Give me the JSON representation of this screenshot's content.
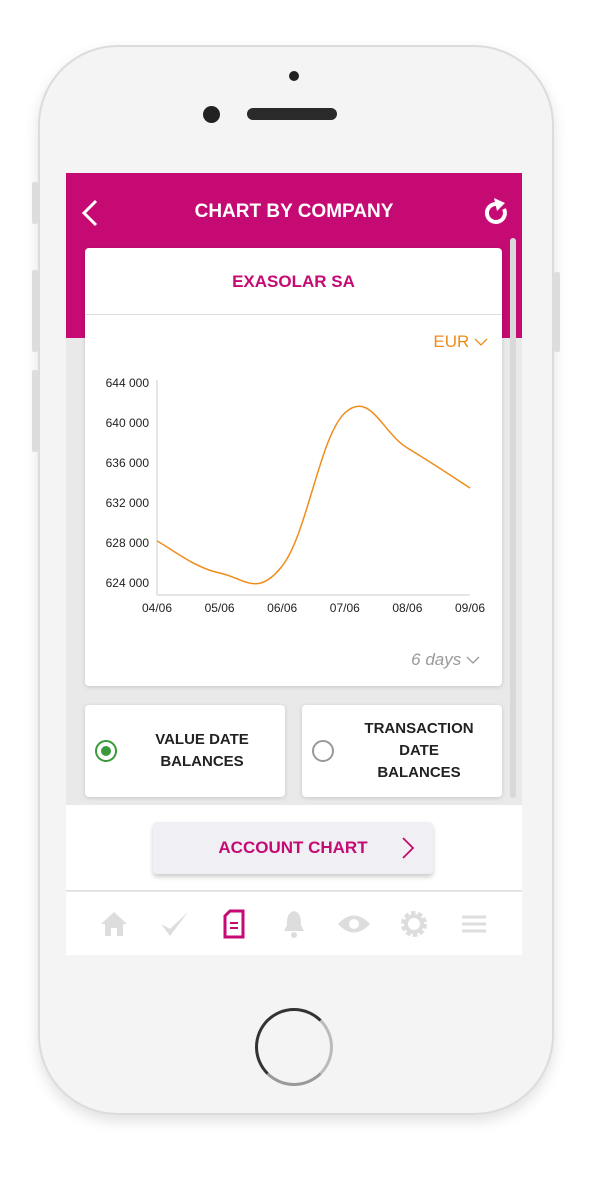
{
  "header": {
    "title": "CHART BY COMPANY",
    "back_icon": "chevron-left-icon",
    "refresh_icon": "refresh-icon"
  },
  "card": {
    "company": "EXASOLAR SA",
    "currency": "EUR",
    "period": "6 days"
  },
  "chart_data": {
    "type": "line",
    "categories": [
      "04/06",
      "05/06",
      "06/06",
      "07/06",
      "08/06",
      "09/06"
    ],
    "series": [
      {
        "values": [
          628200,
          625000,
          625700,
          641000,
          637500,
          633500
        ],
        "color": "#ef8c1a"
      }
    ],
    "yticks": [
      "624 000",
      "628 000",
      "632 000",
      "636 000",
      "640 000",
      "644 000"
    ],
    "ytick_values": [
      624000,
      628000,
      632000,
      636000,
      640000,
      644000
    ],
    "ylim": [
      622800,
      644000
    ],
    "grid": false
  },
  "options": [
    {
      "label": "VALUE DATE BALANCES",
      "selected": true
    },
    {
      "label": "TRANSACTION DATE BALANCES",
      "selected": false
    }
  ],
  "account_button": "ACCOUNT CHART",
  "tabbar": [
    {
      "icon": "home-icon",
      "active": false
    },
    {
      "icon": "check-icon",
      "active": false
    },
    {
      "icon": "document-icon",
      "active": true
    },
    {
      "icon": "bell-icon",
      "active": false
    },
    {
      "icon": "eye-icon",
      "active": false
    },
    {
      "icon": "gear-icon",
      "active": false
    },
    {
      "icon": "menu-icon",
      "active": false
    }
  ],
  "colors": {
    "brand": "#c50a74",
    "line": "#ef8c1a",
    "selected": "#3a9a3a"
  }
}
